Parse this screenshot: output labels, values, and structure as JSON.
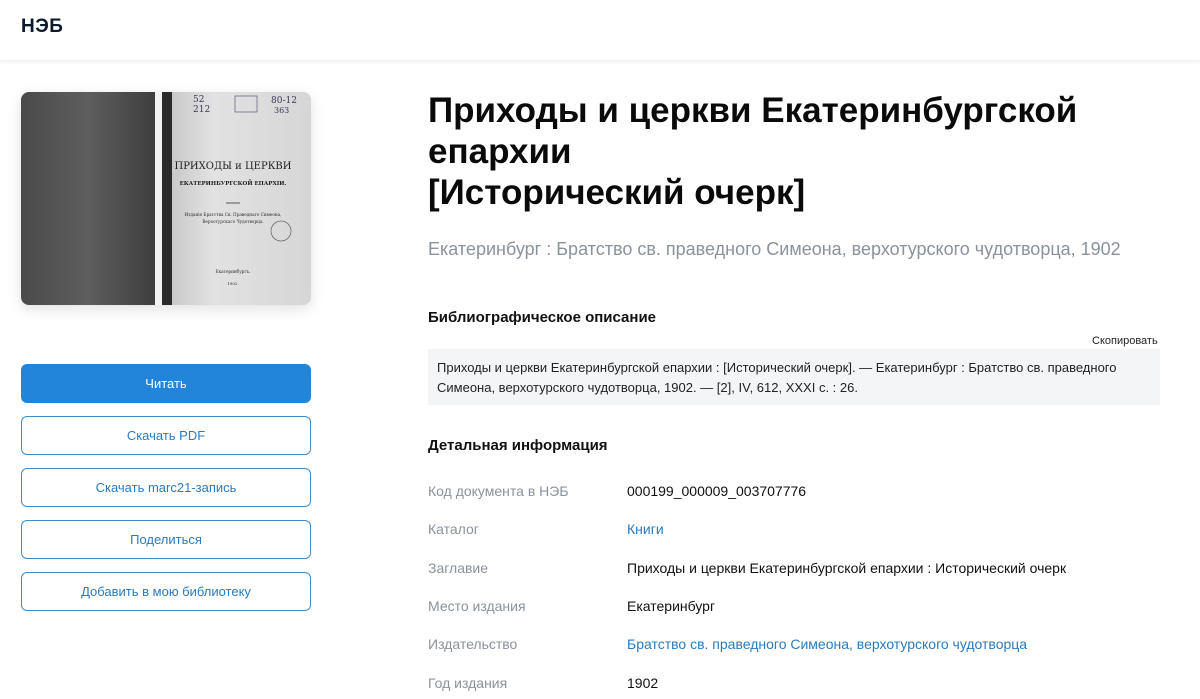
{
  "header": {
    "logo": "НЭБ"
  },
  "actions": {
    "read": "Читать",
    "download_pdf": "Скачать PDF",
    "download_marc": "Скачать marc21-запись",
    "share": "Поделиться",
    "add_library": "Добавить в мою библиотеку"
  },
  "book": {
    "title_line1": "Приходы и церкви Екатеринбургской",
    "title_line2": "епархии",
    "title_line3": "[Исторический очерк]",
    "subtitle": "Екатеринбург : Братство св. праведного Симеона, верхотурского чудотворца, 1902"
  },
  "cover": {
    "mark1": "52",
    "mark2": "212",
    "mark3": "80-12",
    "mark4": "363",
    "line1": "ПРИХОДЫ и ЦЕРКВИ",
    "line2": "ЕКАТЕРИНБУРГСКОЙ ЕПАРХІИ.",
    "line3": "Изданіе Братства Св. Праведнаго Симеона,",
    "line4": "Верхотурскаго Чудотворца.",
    "line5": "Екатеринбургъ.",
    "line6": "1902."
  },
  "bibliographic": {
    "heading": "Библиографическое описание",
    "copy_label": "Скопировать",
    "line1": "Приходы и церкви Екатеринбургской епархии : [Исторический очерк]. — Екатеринбург : Братство св. праведного",
    "line2": "Симеона, верхотурского чудотворца, 1902. — [2], IV, 612, XXXI с. : 26."
  },
  "details": {
    "heading": "Детальная информация",
    "rows": [
      {
        "label": "Код документа в НЭБ",
        "value": "000199_000009_003707776"
      },
      {
        "label": "Каталог",
        "value": "Книги"
      },
      {
        "label": "Заглавие",
        "value": "Приходы и церкви Екатеринбургской епархии : Исторический очерк"
      },
      {
        "label": "Место издания",
        "value": "Екатеринбург"
      },
      {
        "label": "Издательство",
        "value": "Братство св. праведного Симеона, верхотурского чудотворца"
      },
      {
        "label": "Год издания",
        "value": "1902"
      }
    ]
  },
  "colors": {
    "accent": "#2385d9",
    "link": "#2a7bbf",
    "muted": "#8a929c",
    "panel": "#f4f5f7"
  }
}
